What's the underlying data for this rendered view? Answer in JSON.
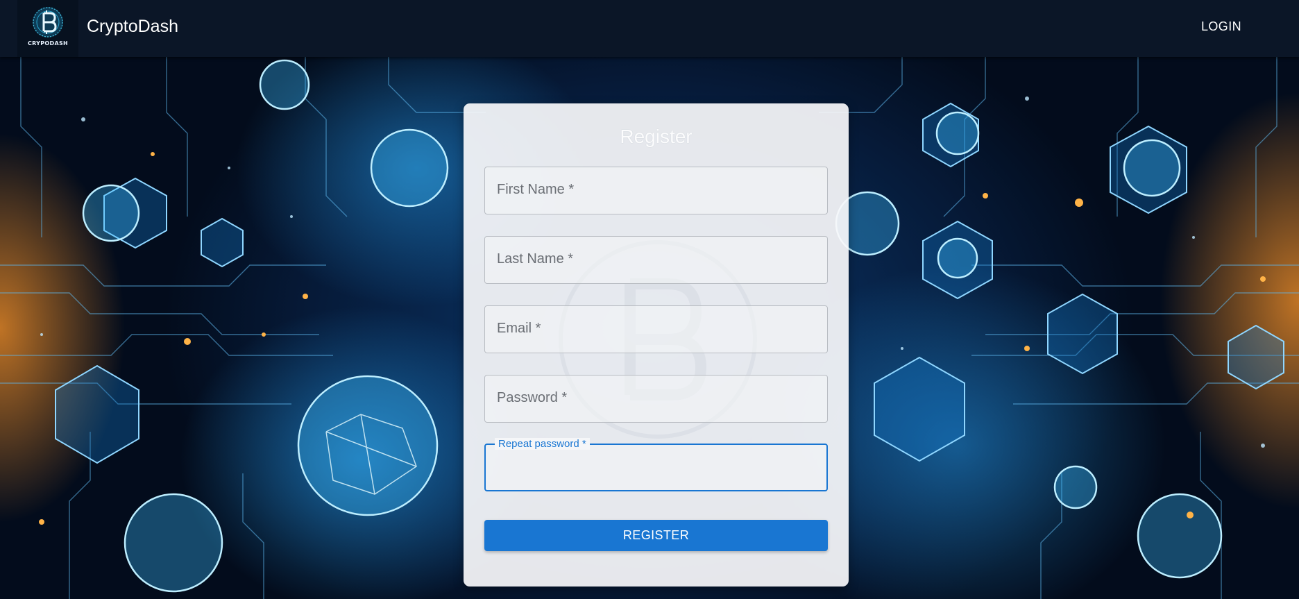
{
  "header": {
    "logo_text": "CRYPODASH",
    "brand": "CryptoDash",
    "login_label": "LOGIN"
  },
  "form": {
    "title": "Register",
    "fields": [
      {
        "label": "First Name *",
        "value": ""
      },
      {
        "label": "Last Name *",
        "value": ""
      },
      {
        "label": "Email *",
        "value": ""
      },
      {
        "label": "Password *",
        "value": ""
      },
      {
        "label": "Repeat password *",
        "value": "",
        "focused": true
      }
    ],
    "submit_label": "REGISTER"
  },
  "colors": {
    "appbar": "#0b1627",
    "primary": "#1976d2",
    "card": "#f8f8fa"
  },
  "icons": [
    "cryptodash-logo-icon",
    "bitcoin-watermark-icon"
  ]
}
